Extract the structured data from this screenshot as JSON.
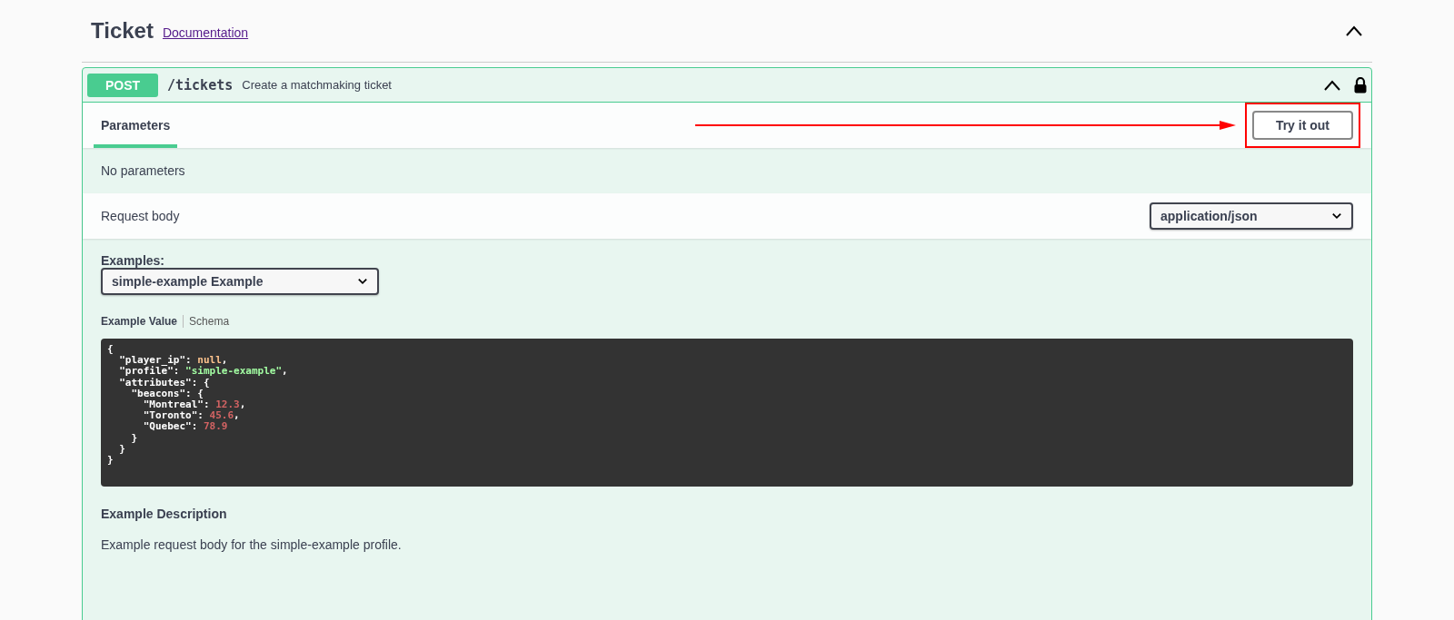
{
  "section": {
    "title": "Ticket",
    "link": "Documentation",
    "expanded": true
  },
  "operation": {
    "method": "POST",
    "path": "/tickets",
    "summary": "Create a matchmaking ticket",
    "expanded": true,
    "locked": true
  },
  "tabs": [
    {
      "label": "Parameters",
      "selected": true
    }
  ],
  "try_button": "Try it out",
  "parameters_text": "No parameters",
  "request_body": {
    "label": "Request body",
    "content_type": "application/json"
  },
  "examples": {
    "label": "Examples:",
    "value": "simple-example Example"
  },
  "example_tabs": [
    {
      "label": "Example Value",
      "selected": true
    },
    {
      "label": "Schema",
      "selected": false
    }
  ],
  "code_lines": [
    [
      {
        "kind": "punct",
        "text": "{"
      }
    ],
    [
      {
        "kind": "key",
        "text": "  \"player_ip\": "
      },
      {
        "kind": "null",
        "text": "null"
      },
      {
        "kind": "punct",
        "text": ","
      }
    ],
    [
      {
        "kind": "key",
        "text": "  \"profile\": "
      },
      {
        "kind": "string",
        "text": "\"simple-example\""
      },
      {
        "kind": "punct",
        "text": ","
      }
    ],
    [
      {
        "kind": "key",
        "text": "  \"attributes\": {"
      }
    ],
    [
      {
        "kind": "key",
        "text": "    \"beacons\": {"
      }
    ],
    [
      {
        "kind": "key",
        "text": "      \"Montreal\": "
      },
      {
        "kind": "number",
        "text": "12.3"
      },
      {
        "kind": "punct",
        "text": ","
      }
    ],
    [
      {
        "kind": "key",
        "text": "      \"Toronto\": "
      },
      {
        "kind": "number",
        "text": "45.6"
      },
      {
        "kind": "punct",
        "text": ","
      }
    ],
    [
      {
        "kind": "key",
        "text": "      \"Quebec\": "
      },
      {
        "kind": "number",
        "text": "78.9"
      }
    ],
    [
      {
        "kind": "punct",
        "text": "    }"
      }
    ],
    [
      {
        "kind": "punct",
        "text": "  }"
      }
    ],
    [
      {
        "kind": "punct",
        "text": "}"
      }
    ]
  ],
  "description": {
    "title": "Example Description",
    "text": "Example request body for the simple-example profile."
  }
}
